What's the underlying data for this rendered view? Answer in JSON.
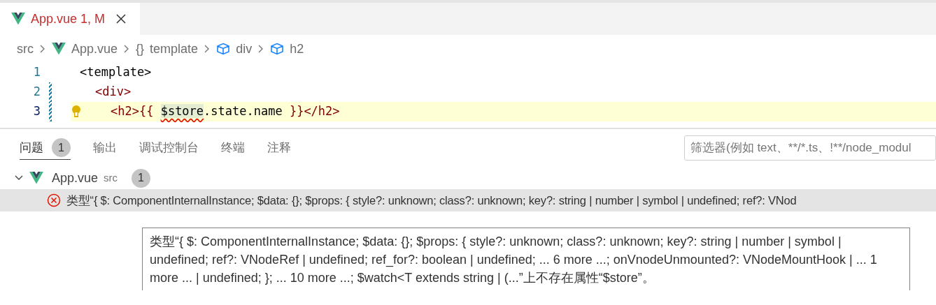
{
  "editor_tab": {
    "label": "App.vue",
    "badge": "1, M",
    "selected": true
  },
  "breadcrumb": [
    {
      "kind": "folder",
      "label": "src"
    },
    {
      "kind": "vue",
      "label": "App.vue"
    },
    {
      "kind": "braces",
      "icon": "{}",
      "label": "template"
    },
    {
      "kind": "element",
      "label": "div"
    },
    {
      "kind": "element",
      "label": "h2"
    }
  ],
  "code_lines": [
    {
      "number": "1",
      "modified": false,
      "current": false,
      "tokens": [
        {
          "kind": "plain",
          "text": "<template>"
        }
      ],
      "children": [
        {
          "number": "2",
          "modified": true,
          "current": false,
          "tokens": [
            {
              "kind": "tag",
              "text": "<div>"
            }
          ],
          "children": [
            {
              "number": "3",
              "modified": true,
              "current": true,
              "tokens": [
                {
                  "kind": "tag",
                  "text": "<h2>{{ "
                },
                {
                  "kind": "error",
                  "text": "$store"
                },
                {
                  "kind": "plain",
                  "text": ".state.name "
                },
                {
                  "kind": "tag",
                  "text": "}}</h2>"
                }
              ]
            }
          ]
        }
      ]
    }
  ],
  "panel": {
    "tabs": [
      {
        "label": "问题",
        "count": "1",
        "selected": true
      },
      {
        "label": "输出",
        "selected": false
      },
      {
        "label": "调试控制台",
        "selected": false
      },
      {
        "label": "终端",
        "selected": false
      },
      {
        "label": "注释",
        "selected": false
      }
    ],
    "filter": {
      "placeholder": "筛选器(例如 text、**/*.ts、!**/node_modul"
    },
    "file_group": {
      "name": "App.vue",
      "folder": "src",
      "count": "1",
      "expanded": true
    },
    "problems": [
      {
        "kind": "error",
        "message": "类型“{ $: ComponentInternalInstance; $data: {}; $props: { style?: unknown; class?: unknown; key?: string | number | symbol | undefined; ref?: VNod",
        "selected": true
      }
    ]
  },
  "hover": {
    "message": "类型“{ $: ComponentInternalInstance; $data: {}; $props: { style?: unknown; class?: unknown; key?: string | number | symbol | undefined; ref?: VNodeRef | undefined; ref_for?: boolean | undefined; ... 6 more ...; onVnodeUnmounted?: VNodeMountHook | ... 1 more ... | undefined; }; ... 10 more ...; $watch<T extends string | (...”上不存在属性“$store”。"
  }
}
